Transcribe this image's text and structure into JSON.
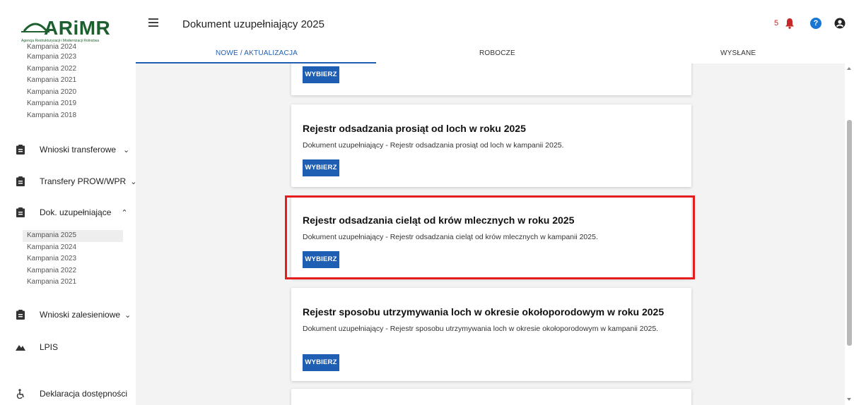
{
  "logo": {
    "text": "ARiMR",
    "subtitle": "Agencja Restrukturyzacji i Modernizacji Rolnictwa"
  },
  "sidebar": {
    "top_campaigns": [
      "Kampania 2024",
      "Kampania 2023",
      "Kampania 2022",
      "Kampania 2021",
      "Kampania 2020",
      "Kampania 2019",
      "Kampania 2018"
    ],
    "nav": {
      "wnioski_transferowe": "Wnioski transferowe",
      "transfery": "Transfery PROW/WPR",
      "dok_uzupelniajace": "Dok. uzupełniające",
      "wnioski_zalesieniowe": "Wnioski zalesieniowe",
      "lpis": "LPIS",
      "deklaracja": "Deklaracja dostępności"
    },
    "dok_campaigns": [
      "Kampania 2025",
      "Kampania 2024",
      "Kampania 2023",
      "Kampania 2022",
      "Kampania 2021"
    ],
    "active_campaign": "Kampania 2025"
  },
  "header": {
    "title": "Dokument uzupełniający 2025",
    "notification_count": "5",
    "help_glyph": "?",
    "tabs": [
      "NOWE / AKTUALIZACJA",
      "ROBOCZE",
      "WYSŁANE"
    ],
    "active_tab": "NOWE / AKTUALIZACJA"
  },
  "cards": [
    {
      "title": "",
      "description": "",
      "button": "WYBIERZ"
    },
    {
      "title": "Rejestr odsadzania prosiąt od loch w roku 2025",
      "description": "Dokument uzupełniający - Rejestr odsadzania prosiąt od loch w kampanii 2025.",
      "button": "WYBIERZ"
    },
    {
      "title": "Rejestr odsadzania cieląt od krów mlecznych w roku 2025",
      "description": "Dokument uzupełniający - Rejestr odsadzania cieląt od krów mlecznych w kampanii 2025.",
      "button": "WYBIERZ",
      "highlighted": true
    },
    {
      "title": "Rejestr sposobu utrzymywania loch w okresie okołoporodowym w roku 2025",
      "description": "Dokument uzupełniający - Rejestr sposobu utrzymywania loch w okresie okołoporodowym w kampanii 2025.",
      "button": "WYBIERZ"
    }
  ],
  "colors": {
    "primary": "#1e5fb3",
    "brand_green": "#1d5f2e",
    "highlight": "#e41e1e",
    "notification": "#c62828"
  }
}
